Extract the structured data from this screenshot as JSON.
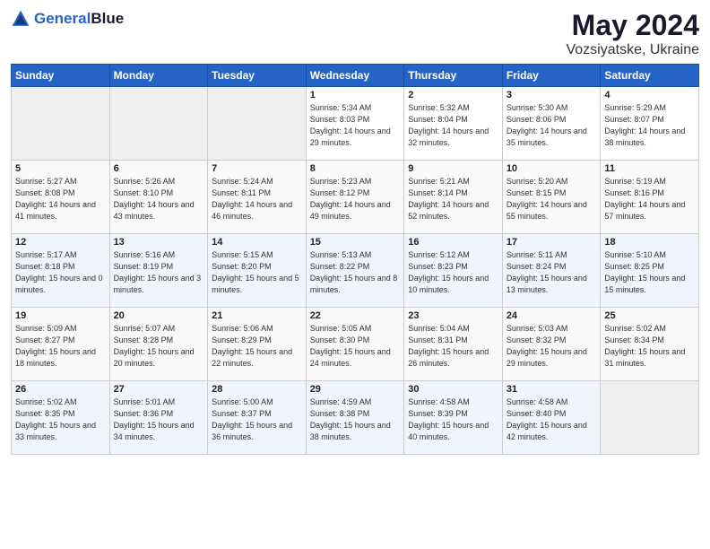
{
  "header": {
    "logo_line1": "General",
    "logo_line2": "Blue",
    "title": "May 2024",
    "location": "Vozsiyatske, Ukraine"
  },
  "weekdays": [
    "Sunday",
    "Monday",
    "Tuesday",
    "Wednesday",
    "Thursday",
    "Friday",
    "Saturday"
  ],
  "weeks": [
    [
      {
        "day": "",
        "info": ""
      },
      {
        "day": "",
        "info": ""
      },
      {
        "day": "",
        "info": ""
      },
      {
        "day": "1",
        "info": "Sunrise: 5:34 AM\nSunset: 8:03 PM\nDaylight: 14 hours\nand 29 minutes."
      },
      {
        "day": "2",
        "info": "Sunrise: 5:32 AM\nSunset: 8:04 PM\nDaylight: 14 hours\nand 32 minutes."
      },
      {
        "day": "3",
        "info": "Sunrise: 5:30 AM\nSunset: 8:06 PM\nDaylight: 14 hours\nand 35 minutes."
      },
      {
        "day": "4",
        "info": "Sunrise: 5:29 AM\nSunset: 8:07 PM\nDaylight: 14 hours\nand 38 minutes."
      }
    ],
    [
      {
        "day": "5",
        "info": "Sunrise: 5:27 AM\nSunset: 8:08 PM\nDaylight: 14 hours\nand 41 minutes."
      },
      {
        "day": "6",
        "info": "Sunrise: 5:26 AM\nSunset: 8:10 PM\nDaylight: 14 hours\nand 43 minutes."
      },
      {
        "day": "7",
        "info": "Sunrise: 5:24 AM\nSunset: 8:11 PM\nDaylight: 14 hours\nand 46 minutes."
      },
      {
        "day": "8",
        "info": "Sunrise: 5:23 AM\nSunset: 8:12 PM\nDaylight: 14 hours\nand 49 minutes."
      },
      {
        "day": "9",
        "info": "Sunrise: 5:21 AM\nSunset: 8:14 PM\nDaylight: 14 hours\nand 52 minutes."
      },
      {
        "day": "10",
        "info": "Sunrise: 5:20 AM\nSunset: 8:15 PM\nDaylight: 14 hours\nand 55 minutes."
      },
      {
        "day": "11",
        "info": "Sunrise: 5:19 AM\nSunset: 8:16 PM\nDaylight: 14 hours\nand 57 minutes."
      }
    ],
    [
      {
        "day": "12",
        "info": "Sunrise: 5:17 AM\nSunset: 8:18 PM\nDaylight: 15 hours\nand 0 minutes."
      },
      {
        "day": "13",
        "info": "Sunrise: 5:16 AM\nSunset: 8:19 PM\nDaylight: 15 hours\nand 3 minutes."
      },
      {
        "day": "14",
        "info": "Sunrise: 5:15 AM\nSunset: 8:20 PM\nDaylight: 15 hours\nand 5 minutes."
      },
      {
        "day": "15",
        "info": "Sunrise: 5:13 AM\nSunset: 8:22 PM\nDaylight: 15 hours\nand 8 minutes."
      },
      {
        "day": "16",
        "info": "Sunrise: 5:12 AM\nSunset: 8:23 PM\nDaylight: 15 hours\nand 10 minutes."
      },
      {
        "day": "17",
        "info": "Sunrise: 5:11 AM\nSunset: 8:24 PM\nDaylight: 15 hours\nand 13 minutes."
      },
      {
        "day": "18",
        "info": "Sunrise: 5:10 AM\nSunset: 8:25 PM\nDaylight: 15 hours\nand 15 minutes."
      }
    ],
    [
      {
        "day": "19",
        "info": "Sunrise: 5:09 AM\nSunset: 8:27 PM\nDaylight: 15 hours\nand 18 minutes."
      },
      {
        "day": "20",
        "info": "Sunrise: 5:07 AM\nSunset: 8:28 PM\nDaylight: 15 hours\nand 20 minutes."
      },
      {
        "day": "21",
        "info": "Sunrise: 5:06 AM\nSunset: 8:29 PM\nDaylight: 15 hours\nand 22 minutes."
      },
      {
        "day": "22",
        "info": "Sunrise: 5:05 AM\nSunset: 8:30 PM\nDaylight: 15 hours\nand 24 minutes."
      },
      {
        "day": "23",
        "info": "Sunrise: 5:04 AM\nSunset: 8:31 PM\nDaylight: 15 hours\nand 26 minutes."
      },
      {
        "day": "24",
        "info": "Sunrise: 5:03 AM\nSunset: 8:32 PM\nDaylight: 15 hours\nand 29 minutes."
      },
      {
        "day": "25",
        "info": "Sunrise: 5:02 AM\nSunset: 8:34 PM\nDaylight: 15 hours\nand 31 minutes."
      }
    ],
    [
      {
        "day": "26",
        "info": "Sunrise: 5:02 AM\nSunset: 8:35 PM\nDaylight: 15 hours\nand 33 minutes."
      },
      {
        "day": "27",
        "info": "Sunrise: 5:01 AM\nSunset: 8:36 PM\nDaylight: 15 hours\nand 34 minutes."
      },
      {
        "day": "28",
        "info": "Sunrise: 5:00 AM\nSunset: 8:37 PM\nDaylight: 15 hours\nand 36 minutes."
      },
      {
        "day": "29",
        "info": "Sunrise: 4:59 AM\nSunset: 8:38 PM\nDaylight: 15 hours\nand 38 minutes."
      },
      {
        "day": "30",
        "info": "Sunrise: 4:58 AM\nSunset: 8:39 PM\nDaylight: 15 hours\nand 40 minutes."
      },
      {
        "day": "31",
        "info": "Sunrise: 4:58 AM\nSunset: 8:40 PM\nDaylight: 15 hours\nand 42 minutes."
      },
      {
        "day": "",
        "info": ""
      }
    ]
  ]
}
